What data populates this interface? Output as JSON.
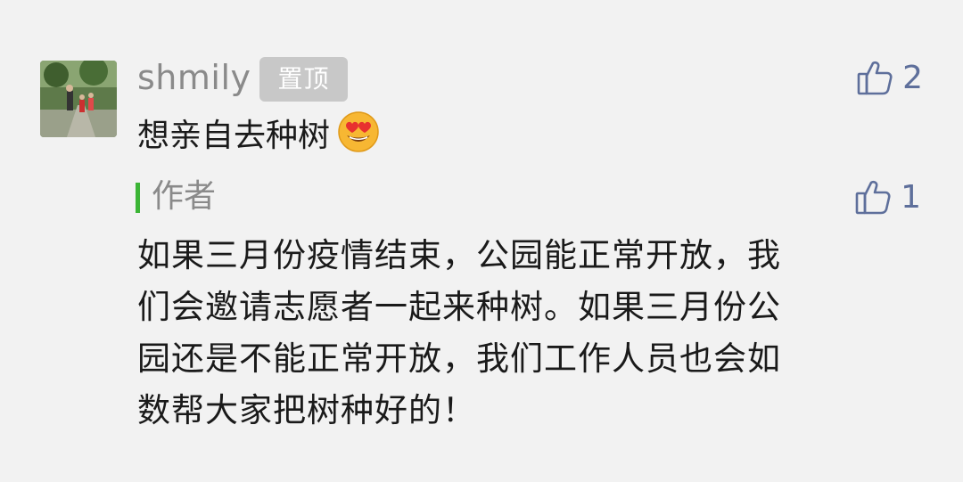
{
  "comment": {
    "username": "shmily",
    "pin_badge": "置顶",
    "text": "想亲自去种树",
    "like_count": "2",
    "emoji_icon": "heart-eyes-emoji"
  },
  "reply": {
    "author_label": "作者",
    "like_count": "1",
    "lines": [
      "如果三月份疫情结束，公园能正常开放，我",
      "们会邀请志愿者一起来种树。如果三月份公",
      "园还是不能正常开放，我们工作人员也会如",
      "数帮大家把树种好的！"
    ]
  },
  "colors": {
    "background": "#f2f2f2",
    "accent_green": "#3cb536",
    "like_blue": "#5e6f9b",
    "muted_gray": "#8a8a8a"
  }
}
